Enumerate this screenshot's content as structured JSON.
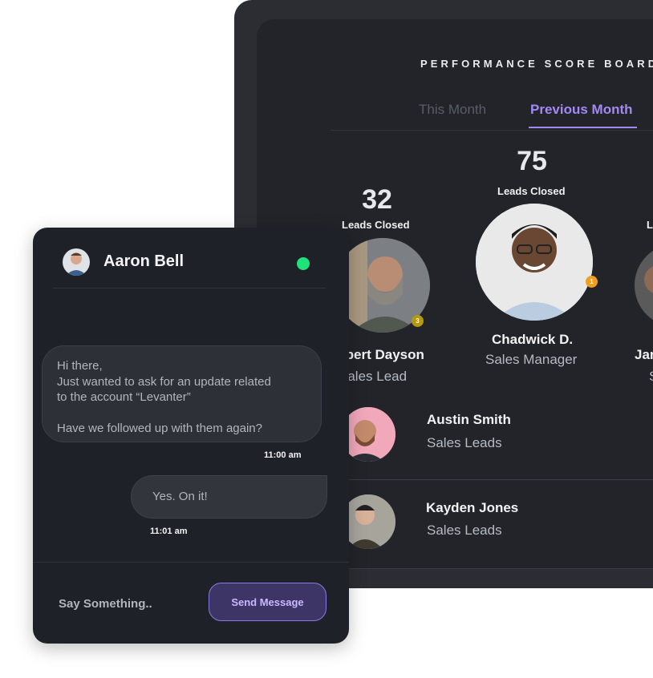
{
  "board": {
    "title": "PERFORMANCE SCORE BOARD",
    "tabs": [
      {
        "label": "This Month",
        "active": false
      },
      {
        "label": "Previous Month",
        "active": true
      }
    ],
    "podium": [
      {
        "rank": 2,
        "score": "32",
        "score_label": "Leads Closed",
        "name": "Robert Dayson",
        "role": "Sales Lead",
        "medal": "3",
        "medal_color": "#b59a10"
      },
      {
        "rank": 1,
        "score": "75",
        "score_label": "Leads Closed",
        "name": "Chadwick D.",
        "role": "Sales Manager",
        "medal": "1",
        "medal_color": "#f0a020"
      },
      {
        "rank": 3,
        "score_label": "Leads Closed",
        "name": "James",
        "role": "Sales"
      }
    ],
    "list": [
      {
        "name": "Austin Smith",
        "role": "Sales Leads"
      },
      {
        "name": "Kayden Jones",
        "role": "Sales Leads"
      }
    ]
  },
  "chat": {
    "contact_name": "Aaron Bell",
    "status": "online",
    "status_color": "#1fe27a",
    "messages": [
      {
        "direction": "incoming",
        "lines": [
          "Hi there,",
          "Just wanted to ask for an update related",
          "to the account “Levanter”",
          "",
          "Have we followed up with them again?"
        ],
        "time": "11:00 am"
      },
      {
        "direction": "outgoing",
        "text": "Yes. On it!",
        "time": "11:01 am"
      }
    ],
    "input_placeholder": "Say Something..",
    "send_label": "Send Message"
  },
  "colors": {
    "accent": "#a389f4",
    "panel": "#22242a",
    "card": "#1f2128"
  }
}
